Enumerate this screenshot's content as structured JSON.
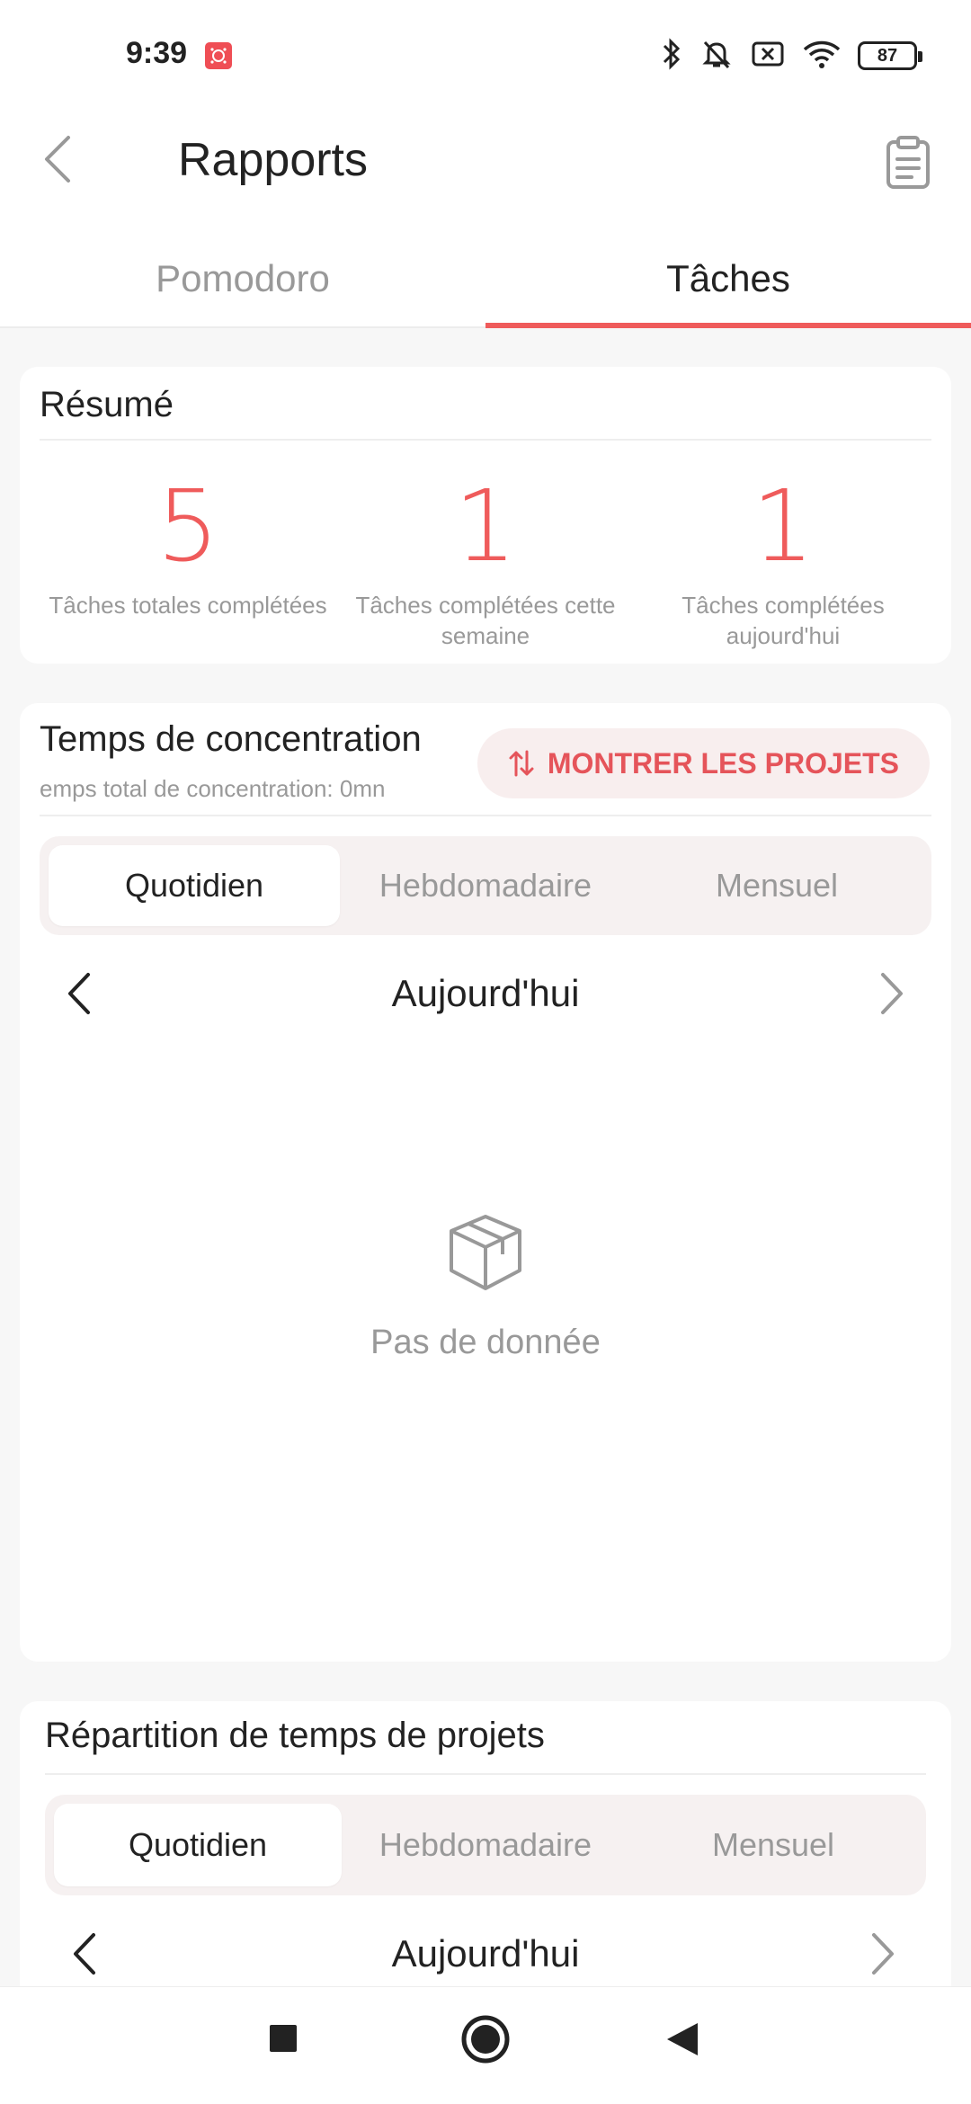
{
  "status": {
    "time": "9:39",
    "battery": "87"
  },
  "header": {
    "title": "Rapports"
  },
  "tabs": [
    {
      "label": "Pomodoro",
      "active": false
    },
    {
      "label": "Tâches",
      "active": true
    }
  ],
  "summary": {
    "title": "Résumé",
    "items": [
      {
        "value": "5",
        "label": "Tâches totales complétées"
      },
      {
        "value": "1",
        "label": "Tâches complétées cette semaine"
      },
      {
        "value": "1",
        "label": "Tâches complétées aujourd'hui"
      }
    ]
  },
  "focus": {
    "title": "Temps de concentration",
    "subtitle": "emps total de concentration: 0mn",
    "show_projects": "MONTRER LES PROJETS",
    "segments": [
      "Quotidien",
      "Hebdomadaire",
      "Mensuel"
    ],
    "active_segment": "Quotidien",
    "period": "Aujourd'hui",
    "empty": "Pas de donnée"
  },
  "distribution": {
    "title": "Répartition de temps de projets",
    "segments": [
      "Quotidien",
      "Hebdomadaire",
      "Mensuel"
    ],
    "active_segment": "Quotidien",
    "period": "Aujourd'hui"
  },
  "colors": {
    "accent": "#ef5b5b",
    "muted": "#999999"
  }
}
